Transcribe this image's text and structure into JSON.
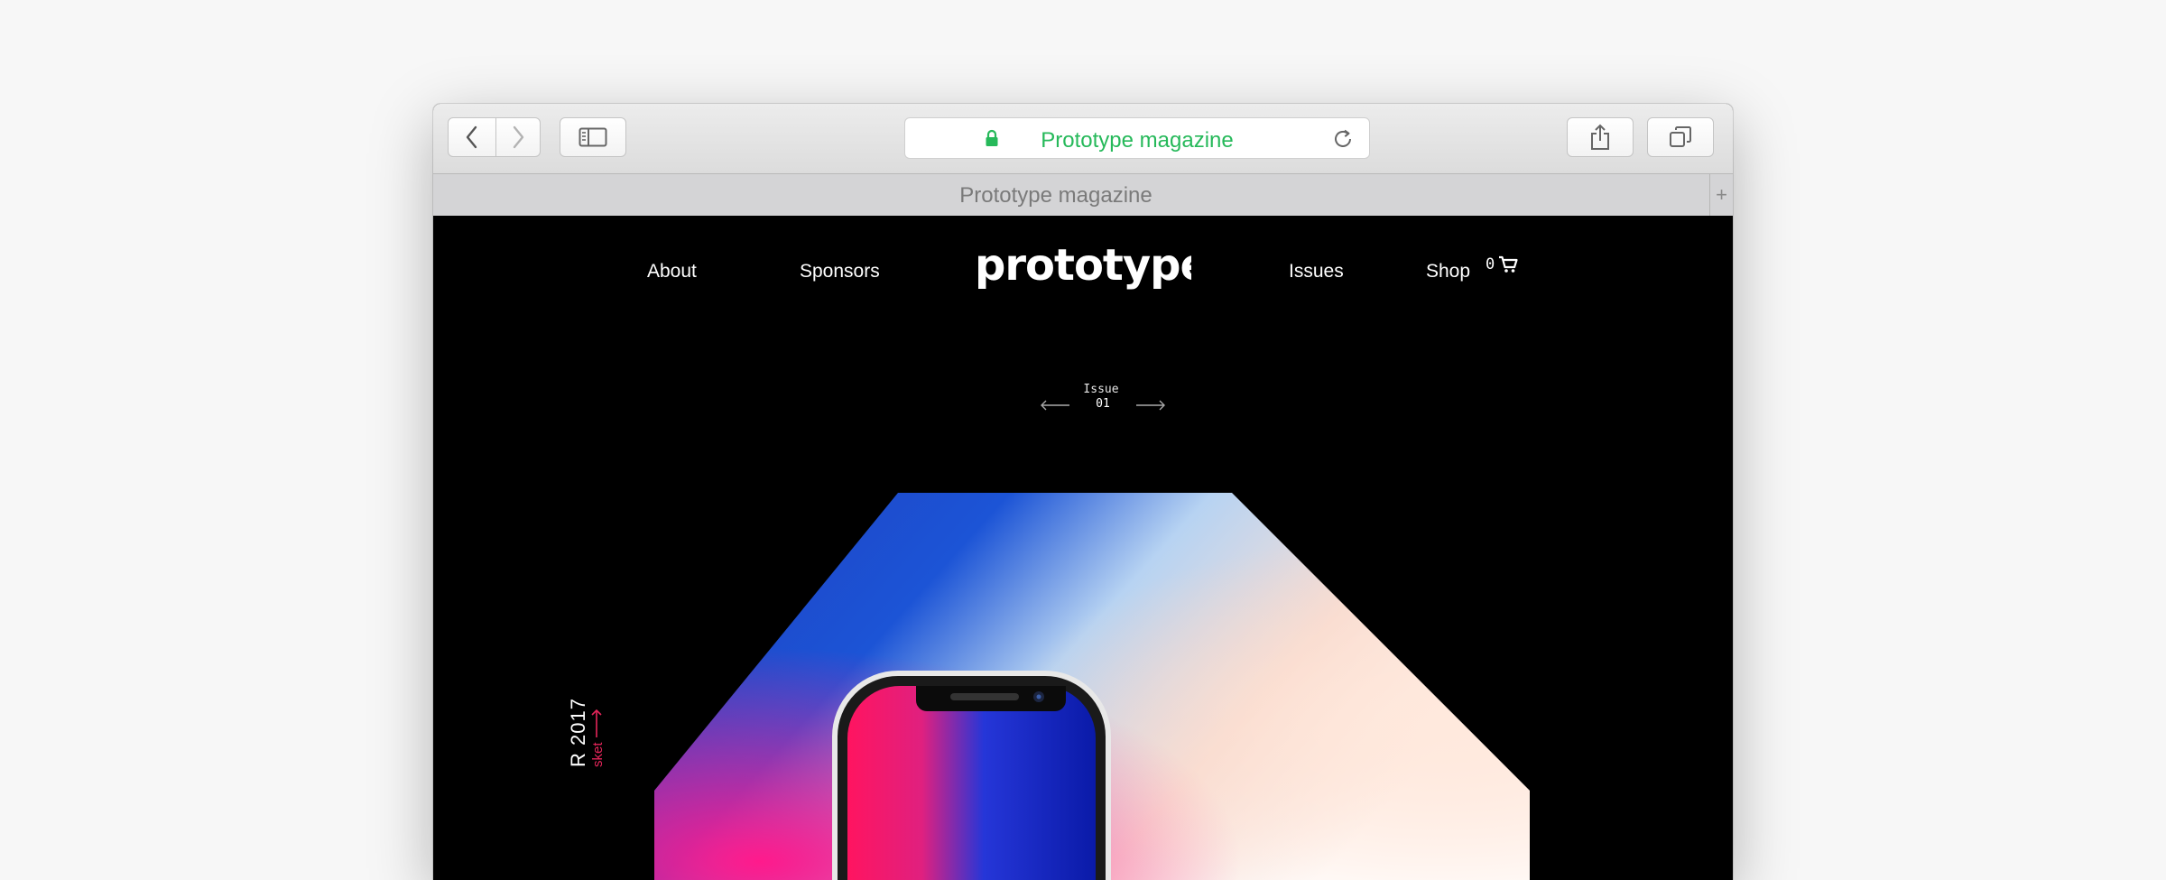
{
  "browser": {
    "url_text": "Prototype magazine",
    "tab_title": "Prototype magazine",
    "new_tab_symbol": "+"
  },
  "nav": {
    "items": [
      "About",
      "Sponsors",
      "Issues",
      "Shop"
    ],
    "logo_text": "prototype",
    "cart_count": "0"
  },
  "issue": {
    "label": "Issue",
    "number": "01"
  },
  "feature": {
    "title_fragment": "R 2017",
    "link_fragment": "sket"
  },
  "colors": {
    "accent_green": "#26b95a",
    "accent_pink": "#e5255a"
  },
  "icons": [
    "back-icon",
    "forward-icon",
    "sidebar-icon",
    "lock-icon",
    "reload-icon",
    "share-icon",
    "tabs-overview-icon",
    "cart-icon"
  ]
}
